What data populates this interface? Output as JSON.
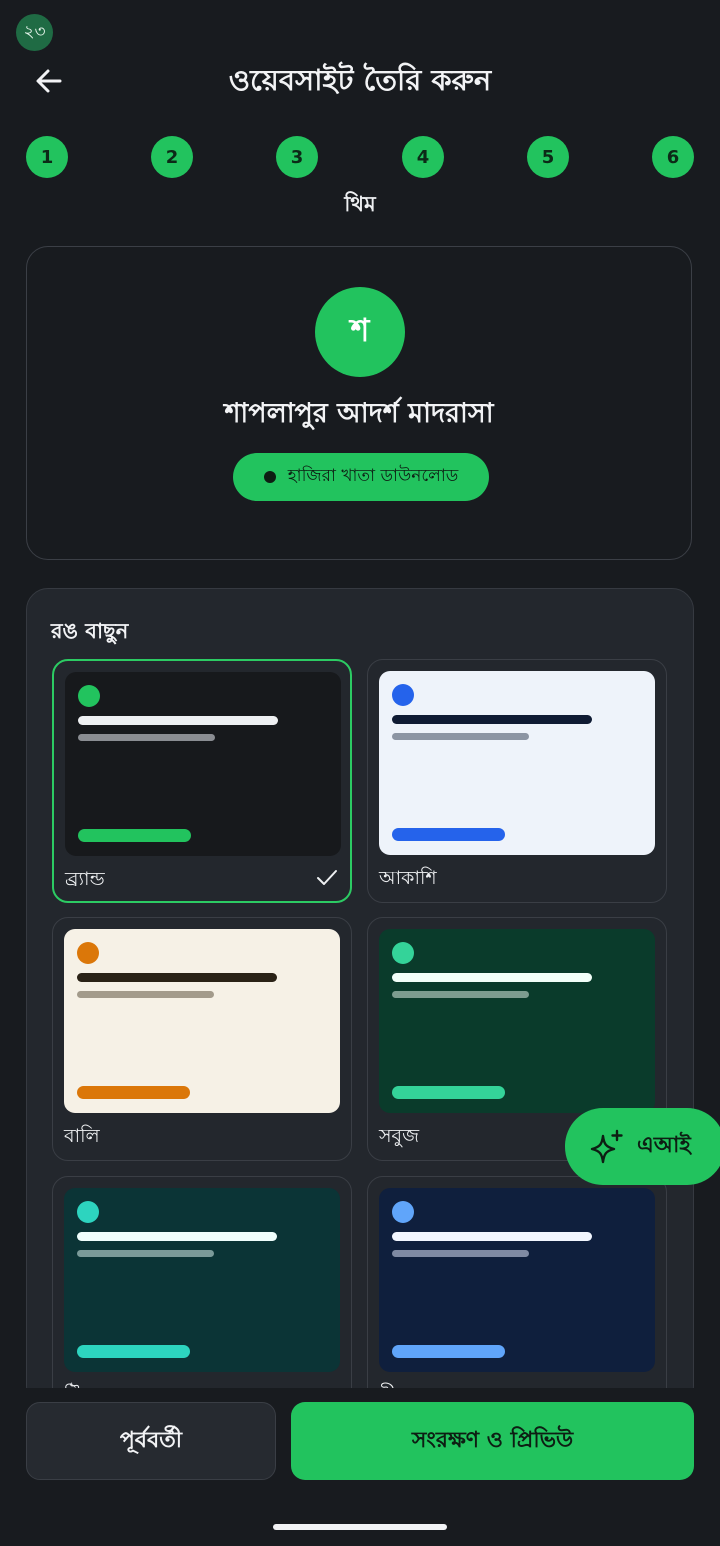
{
  "status": {
    "badge": "২৩"
  },
  "header": {
    "title": "ওয়েবসাইট তৈরি করুন",
    "back_icon": "arrow-left-icon"
  },
  "stepper": {
    "steps": [
      "1",
      "2",
      "3",
      "4",
      "5",
      "6"
    ],
    "current_caption": "থিম",
    "color": "#22c35e"
  },
  "preview": {
    "avatar_letter": "শ",
    "site_name": "শাপলাপুর আদর্শ মাদরাসা",
    "cta_label": "হাজিরা খাতা ডাউনলোড"
  },
  "theme_picker": {
    "title": "রঙ বাছুন",
    "selected": "ব্র্যান্ড",
    "themes": [
      {
        "name": "ব্র্যান্ড",
        "selected": true,
        "bg": "#17191c",
        "dot": "#22c35e",
        "line1": "#eef0f2",
        "line2": "#8a8d92",
        "bar": "#22c35e"
      },
      {
        "name": "আকাশি",
        "selected": false,
        "bg": "#eef3fa",
        "dot": "#2563eb",
        "line1": "#0f1b33",
        "line2": "#8c95a3",
        "bar": "#2563eb"
      },
      {
        "name": "বালি",
        "selected": false,
        "bg": "#f6f1e6",
        "dot": "#db7709",
        "line1": "#2a2216",
        "line2": "#a39b8b",
        "bar": "#db7709"
      },
      {
        "name": "সবুজ",
        "selected": false,
        "bg": "#0a3b2b",
        "dot": "#34d399",
        "line1": "#f2fff9",
        "line2": "#7d9c8f",
        "bar": "#34d399"
      },
      {
        "name": "টিলযুক্ত",
        "selected": false,
        "bg": "#0b3436",
        "dot": "#2dd4bf",
        "line1": "#f0fffd",
        "line2": "#7b9a99",
        "bar": "#2dd4bf"
      },
      {
        "name": "নীল",
        "selected": false,
        "bg": "#0f1f3d",
        "dot": "#60a5fa",
        "line1": "#f2f6ff",
        "line2": "#7f8aa3",
        "bar": "#60a5fa"
      }
    ]
  },
  "fab": {
    "label": "এআই",
    "icon": "sparkle-icon"
  },
  "footer": {
    "prev_label": "পূর্ববর্তী",
    "save_label": "সংরক্ষণ ও প্রিভিউ"
  },
  "colors": {
    "accent": "#22c35e",
    "background": "#181b1f",
    "panel": "#23272d"
  }
}
